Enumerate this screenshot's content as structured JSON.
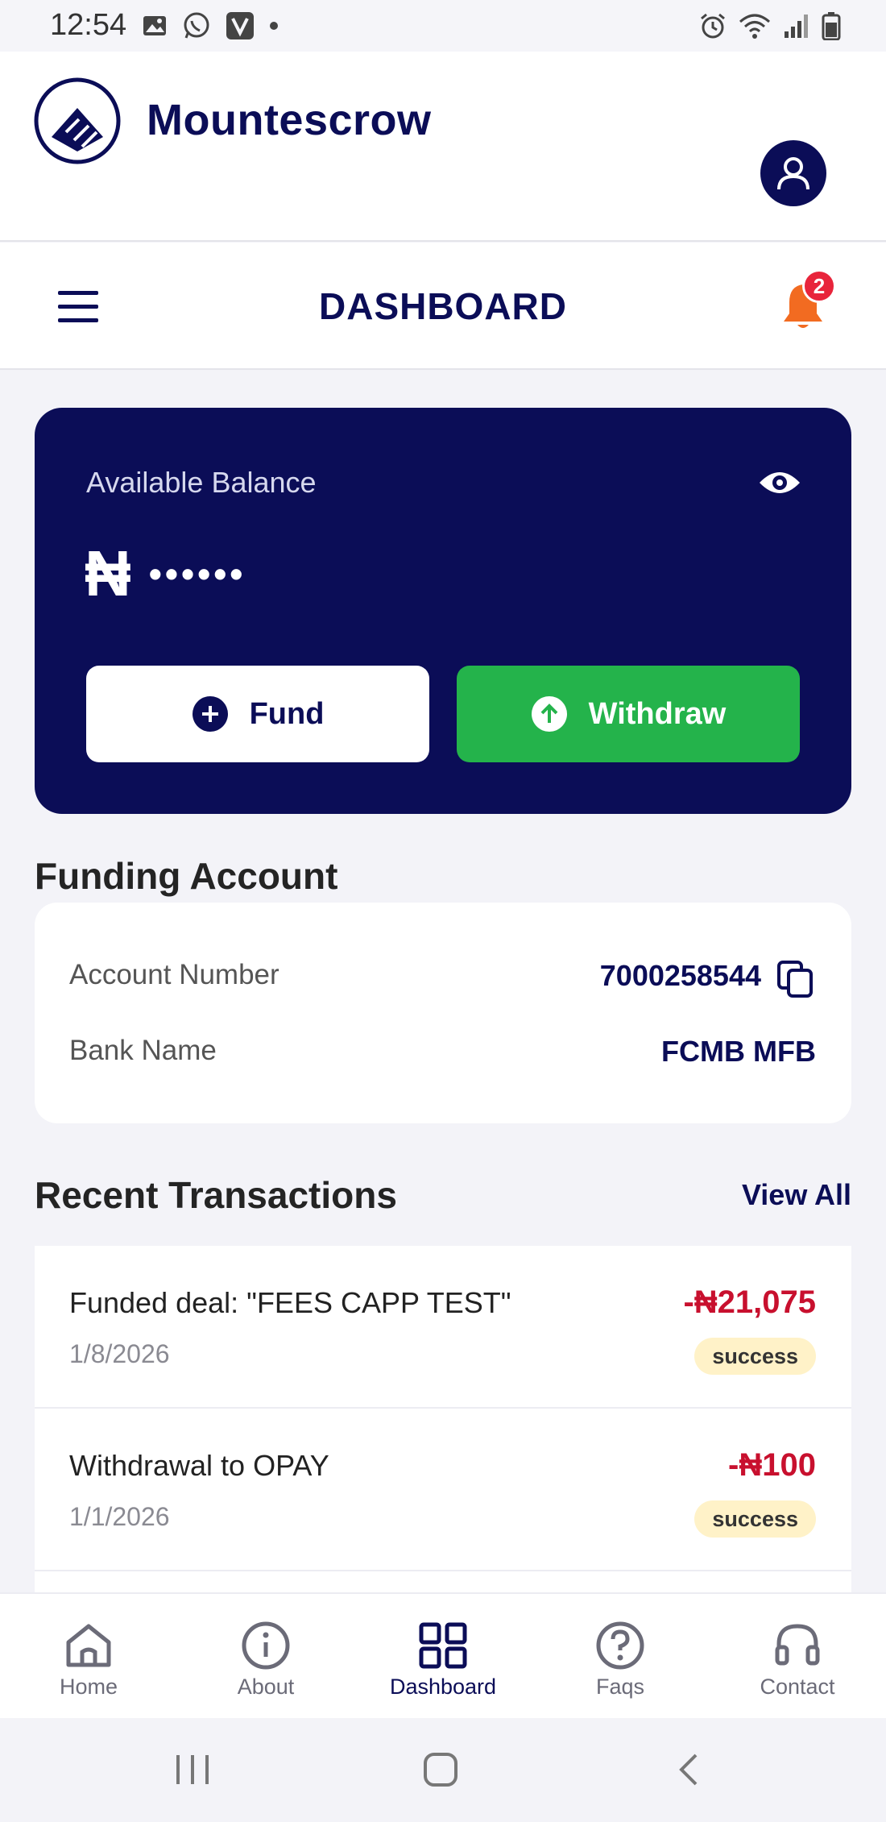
{
  "status_bar": {
    "time": "12:54"
  },
  "header": {
    "brand": "Mountescrow"
  },
  "nav": {
    "title": "DASHBOARD",
    "notification_count": "2"
  },
  "balance": {
    "label": "Available Balance",
    "currency": "₦",
    "masked_value": "••••••",
    "fund_label": "Fund",
    "withdraw_label": "Withdraw"
  },
  "funding": {
    "title": "Funding Account",
    "account_number_label": "Account Number",
    "account_number": "7000258544",
    "bank_name_label": "Bank Name",
    "bank_name": "FCMB MFB"
  },
  "transactions": {
    "title": "Recent Transactions",
    "view_all": "View All",
    "items": [
      {
        "title": "Funded deal: \"FEES CAPP TEST\"",
        "date": "1/8/2026",
        "amount": "-₦21,075",
        "status": "success"
      },
      {
        "title": "Withdrawal to OPAY",
        "date": "1/1/2026",
        "amount": "-₦100",
        "status": "success"
      }
    ]
  },
  "bottom_nav": {
    "tabs": [
      {
        "label": "Home"
      },
      {
        "label": "About"
      },
      {
        "label": "Dashboard"
      },
      {
        "label": "Faqs"
      },
      {
        "label": "Contact"
      }
    ],
    "active": "Dashboard"
  },
  "colors": {
    "brand": "#0b0d57",
    "withdraw": "#24b34b",
    "negative": "#c8102e",
    "badge": "#e8243b",
    "bell": "#f26b21"
  },
  "icons": [
    "image-icon",
    "whatsapp-icon",
    "v-app-icon",
    "alarm-icon",
    "wifi-icon",
    "signal-icon",
    "battery-icon",
    "logo-icon",
    "user-icon",
    "menu-icon",
    "bell-icon",
    "eye-icon",
    "plus-circle-icon",
    "arrow-up-circle-icon",
    "copy-icon",
    "home-icon",
    "info-icon",
    "dashboard-icon",
    "question-icon",
    "headset-icon"
  ]
}
